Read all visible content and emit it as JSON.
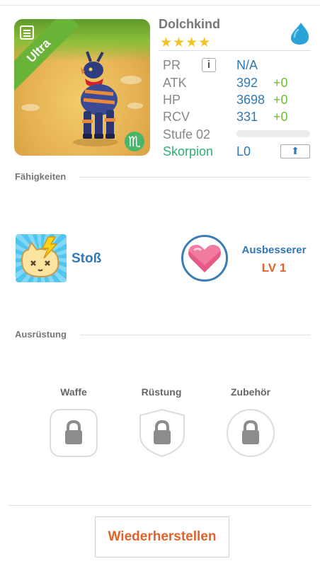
{
  "monster": {
    "name": "Dolchkind",
    "rank_badge": "Ultra",
    "stars": "★★★★",
    "star_count": 4,
    "element": "water",
    "zodiac_symbol": "♏"
  },
  "stats": {
    "pr": {
      "label": "PR",
      "value": "N/A"
    },
    "atk": {
      "label": "ATK",
      "value": "392",
      "bonus": "+0"
    },
    "hp": {
      "label": "HP",
      "value": "3698",
      "bonus": "+0"
    },
    "rcv": {
      "label": "RCV",
      "value": "331",
      "bonus": "+0"
    },
    "stufe": {
      "label": "Stufe 02",
      "exp_progress": 0
    },
    "zodiac": {
      "label": "Skorpion",
      "value": "L0"
    }
  },
  "info_button_label": "i",
  "levelup_button_icon": "up-arrow-icon",
  "skills_section": {
    "title": "Fähigkeiten",
    "active_skill": "Stoß",
    "leader_skill": "Ausbesserer",
    "leader_level": "LV 1"
  },
  "equipment_section": {
    "title": "Ausrüstung",
    "slots": [
      {
        "label": "Waffe",
        "icon": "lock-icon"
      },
      {
        "label": "Rüstung",
        "icon": "lock-icon"
      },
      {
        "label": "Zubehör",
        "icon": "lock-icon"
      }
    ]
  },
  "restore_button": "Wiederherstellen",
  "colors": {
    "accent_blue": "#2f79b8",
    "accent_orange": "#e2622a",
    "bonus_green": "#6cbf35",
    "zodiac_green": "#2fae74",
    "star_yellow": "#f3c321",
    "ribbon_green": "#69b338"
  }
}
